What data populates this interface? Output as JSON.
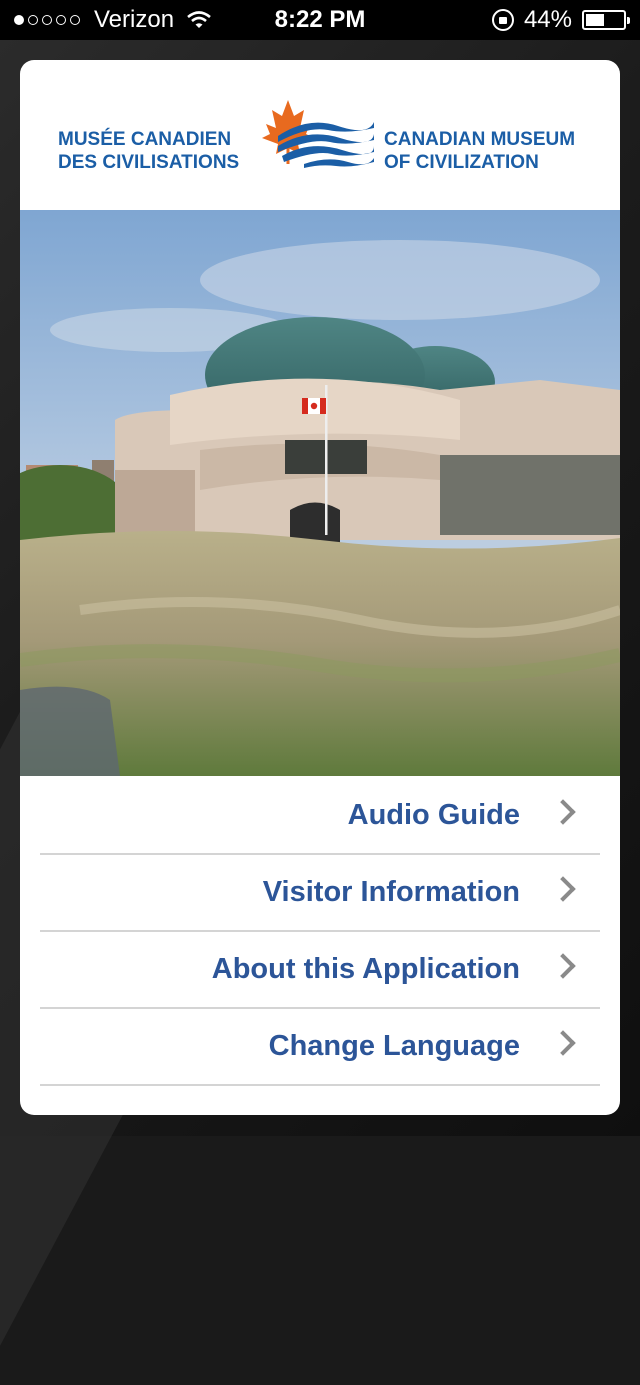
{
  "status_bar": {
    "signal_dots_filled": 1,
    "signal_dots_total": 5,
    "carrier": "Verizon",
    "time": "8:22 PM",
    "battery": "44%",
    "battery_level": 0.44
  },
  "logo": {
    "fr_line1": "MUSÉE CANADIEN",
    "fr_line2": "DES CIVILISATIONS",
    "en_line1": "CANADIAN MUSEUM",
    "en_line2": "OF CIVILIZATION",
    "colors": {
      "text": "#1b5ea6",
      "leaf": "#e86a1f"
    }
  },
  "menu": [
    {
      "label": "Audio Guide"
    },
    {
      "label": "Visitor Information"
    },
    {
      "label": "About this Application"
    },
    {
      "label": "Change Language"
    }
  ],
  "colors": {
    "menu_text": "#2c5598",
    "chevron": "#8a8a8a"
  }
}
